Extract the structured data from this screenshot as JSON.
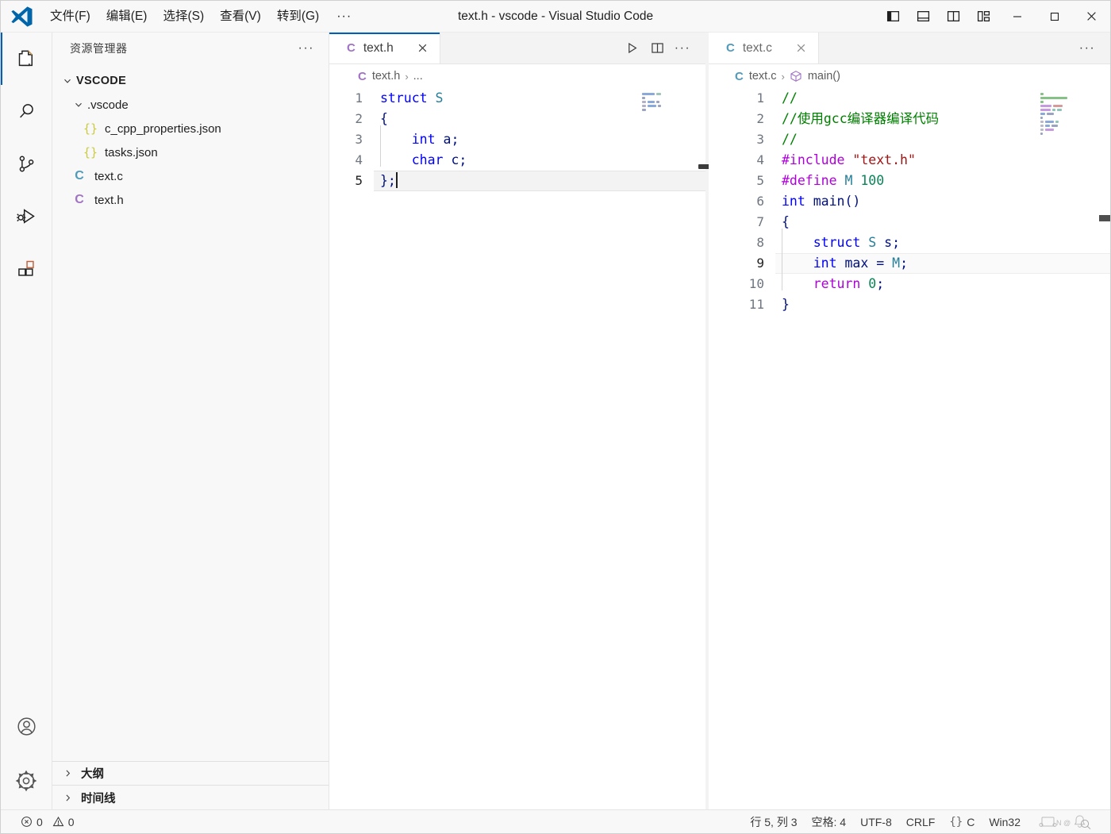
{
  "window": {
    "title": "text.h - vscode - Visual Studio Code",
    "logo_icon": "vscode-logo-icon",
    "menu": [
      {
        "label": "文件(F)",
        "name": "menu-file"
      },
      {
        "label": "编辑(E)",
        "name": "menu-edit"
      },
      {
        "label": "选择(S)",
        "name": "menu-selection"
      },
      {
        "label": "查看(V)",
        "name": "menu-view"
      },
      {
        "label": "转到(G)",
        "name": "menu-go"
      }
    ],
    "menu_more": "···",
    "layout_buttons": [
      {
        "name": "toggle-primary-sidebar-icon",
        "title": "切换主侧栏"
      },
      {
        "name": "toggle-panel-icon",
        "title": "切换面板"
      },
      {
        "name": "toggle-secondary-sidebar-icon",
        "title": "切换辅助侧栏"
      },
      {
        "name": "customize-layout-icon",
        "title": "自定义布局"
      }
    ],
    "controls": [
      {
        "name": "minimize-button",
        "glyph": "minimize-icon"
      },
      {
        "name": "maximize-button",
        "glyph": "maximize-icon"
      },
      {
        "name": "close-button",
        "glyph": "close-icon"
      }
    ]
  },
  "activitybar": {
    "items": [
      {
        "name": "activity-explorer",
        "icon": "files-icon",
        "active": true
      },
      {
        "name": "activity-search",
        "icon": "search-icon",
        "active": false
      },
      {
        "name": "activity-source-control",
        "icon": "source-control-icon",
        "active": false
      },
      {
        "name": "activity-run-debug",
        "icon": "run-and-debug-icon",
        "active": false
      },
      {
        "name": "activity-extensions",
        "icon": "extensions-icon",
        "active": false
      }
    ],
    "bottom": [
      {
        "name": "activity-accounts",
        "icon": "account-icon"
      },
      {
        "name": "activity-settings",
        "icon": "gear-icon"
      }
    ]
  },
  "sidebar": {
    "title": "资源管理器",
    "actions_label": "···",
    "tree": [
      {
        "label": "VSCODE",
        "kind": "root",
        "depth": 0,
        "expanded": true,
        "icon": "chevron-down-icon"
      },
      {
        "label": ".vscode",
        "kind": "folder",
        "depth": 1,
        "expanded": true,
        "icon": "chevron-down-icon"
      },
      {
        "label": "c_cpp_properties.json",
        "kind": "json",
        "depth": 2,
        "icon": "json-file-icon"
      },
      {
        "label": "tasks.json",
        "kind": "json",
        "depth": 2,
        "icon": "json-file-icon"
      },
      {
        "label": "text.c",
        "kind": "c",
        "depth": 1,
        "icon": "c-file-icon"
      },
      {
        "label": "text.h",
        "kind": "h",
        "depth": 1,
        "icon": "h-file-icon"
      }
    ],
    "sections": [
      {
        "label": "大纲",
        "name": "sidebar-section-outline",
        "icon": "chevron-right-icon"
      },
      {
        "label": "时间线",
        "name": "sidebar-section-timeline",
        "icon": "chevron-right-icon"
      }
    ]
  },
  "editor_groups": [
    {
      "name": "editor-group-1",
      "focused": true,
      "tab": {
        "label": "text.h",
        "icon": "h-file-icon",
        "close_icon": "close-icon"
      },
      "actions": [
        {
          "name": "run-code-button",
          "icon": "play-icon"
        },
        {
          "name": "split-editor-right-button",
          "icon": "split-editor-icon"
        },
        {
          "name": "more-actions-button",
          "icon": "ellipsis-icon"
        }
      ],
      "breadcrumb": [
        {
          "label": "text.h",
          "icon": "h-file-icon"
        },
        {
          "label": "...",
          "icon": ""
        }
      ],
      "lines": [
        {
          "n": "1",
          "current": false,
          "tokens": [
            {
              "t": "struct",
              "c": "kw"
            },
            {
              "t": " ",
              "c": "plain"
            },
            {
              "t": "S",
              "c": "typ"
            }
          ]
        },
        {
          "n": "2",
          "current": false,
          "tokens": [
            {
              "t": "{",
              "c": "pun"
            }
          ]
        },
        {
          "n": "3",
          "current": false,
          "indent": true,
          "tokens": [
            {
              "t": "    ",
              "c": "plain"
            },
            {
              "t": "int",
              "c": "kw"
            },
            {
              "t": " ",
              "c": "plain"
            },
            {
              "t": "a",
              "c": "id"
            },
            {
              "t": ";",
              "c": "pun"
            }
          ]
        },
        {
          "n": "4",
          "current": false,
          "indent": true,
          "tokens": [
            {
              "t": "    ",
              "c": "plain"
            },
            {
              "t": "char",
              "c": "kw"
            },
            {
              "t": " ",
              "c": "plain"
            },
            {
              "t": "c",
              "c": "id"
            },
            {
              "t": ";",
              "c": "pun"
            }
          ]
        },
        {
          "n": "5",
          "current": true,
          "cursor": true,
          "tokens": [
            {
              "t": "}",
              "c": "pun"
            },
            {
              "t": ";",
              "c": "pun"
            }
          ]
        }
      ]
    },
    {
      "name": "editor-group-2",
      "focused": false,
      "tab": {
        "label": "text.c",
        "icon": "c-file-icon",
        "close_icon": "close-icon"
      },
      "actions": [
        {
          "name": "more-actions-button",
          "icon": "ellipsis-icon"
        }
      ],
      "breadcrumb": [
        {
          "label": "text.c",
          "icon": "c-file-icon"
        },
        {
          "label": "main()",
          "icon": "symbol-method-icon"
        }
      ],
      "lines": [
        {
          "n": "1",
          "current": false,
          "tokens": [
            {
              "t": "//",
              "c": "cmt"
            }
          ]
        },
        {
          "n": "2",
          "current": false,
          "tokens": [
            {
              "t": "//使用gcc编译器编译代码",
              "c": "cmt"
            }
          ]
        },
        {
          "n": "3",
          "current": false,
          "tokens": [
            {
              "t": "//",
              "c": "cmt"
            }
          ]
        },
        {
          "n": "4",
          "current": false,
          "tokens": [
            {
              "t": "#include",
              "c": "pre"
            },
            {
              "t": " ",
              "c": "plain"
            },
            {
              "t": "\"text.h\"",
              "c": "str"
            }
          ]
        },
        {
          "n": "5",
          "current": false,
          "tokens": [
            {
              "t": "#define",
              "c": "pre"
            },
            {
              "t": " ",
              "c": "plain"
            },
            {
              "t": "M",
              "c": "typ"
            },
            {
              "t": " ",
              "c": "plain"
            },
            {
              "t": "100",
              "c": "num"
            }
          ]
        },
        {
          "n": "6",
          "current": false,
          "tokens": [
            {
              "t": "int",
              "c": "kw"
            },
            {
              "t": " ",
              "c": "plain"
            },
            {
              "t": "main",
              "c": "id"
            },
            {
              "t": "()",
              "c": "pun"
            }
          ]
        },
        {
          "n": "7",
          "current": false,
          "tokens": [
            {
              "t": "{",
              "c": "pun"
            }
          ]
        },
        {
          "n": "8",
          "current": false,
          "indent": true,
          "tokens": [
            {
              "t": "    ",
              "c": "plain"
            },
            {
              "t": "struct",
              "c": "kw"
            },
            {
              "t": " ",
              "c": "plain"
            },
            {
              "t": "S",
              "c": "typ"
            },
            {
              "t": " ",
              "c": "plain"
            },
            {
              "t": "s",
              "c": "id"
            },
            {
              "t": ";",
              "c": "pun"
            }
          ]
        },
        {
          "n": "9",
          "current": true,
          "soft": true,
          "indent": true,
          "tokens": [
            {
              "t": "    ",
              "c": "plain"
            },
            {
              "t": "int",
              "c": "kw"
            },
            {
              "t": " ",
              "c": "plain"
            },
            {
              "t": "max",
              "c": "id"
            },
            {
              "t": " = ",
              "c": "pun"
            },
            {
              "t": "M",
              "c": "typ"
            },
            {
              "t": ";",
              "c": "pun"
            }
          ]
        },
        {
          "n": "10",
          "current": false,
          "indent": true,
          "tokens": [
            {
              "t": "    ",
              "c": "plain"
            },
            {
              "t": "return",
              "c": "ctl"
            },
            {
              "t": " ",
              "c": "plain"
            },
            {
              "t": "0",
              "c": "num"
            },
            {
              "t": ";",
              "c": "pun"
            }
          ]
        },
        {
          "n": "11",
          "current": false,
          "tokens": [
            {
              "t": "}",
              "c": "pun"
            }
          ]
        }
      ]
    }
  ],
  "statusbar": {
    "errors": {
      "icon": "error-icon",
      "count": "0"
    },
    "warnings": {
      "icon": "warning-icon",
      "count": "0"
    },
    "cursor_position": "行 5, 列 3",
    "indentation": "空格: 4",
    "encoding": "UTF-8",
    "eol": "CRLF",
    "language_icon": "{}",
    "language": "C",
    "platform": "Win32",
    "bell_icon": "notifications-bell-icon"
  },
  "colors": {
    "accent": "#005fb8",
    "titlebar_bg": "#f8f8f8",
    "sidebar_bg": "#f8f8f8",
    "editor_bg": "#ffffff",
    "tab_active_bg": "#ffffff",
    "tabbar_bg": "#f3f3f3",
    "c_file_icon": "#519aba",
    "h_file_icon": "#a074c4",
    "json_file_icon": "#cbcb41",
    "comment_green": "#008000",
    "keyword_blue": "#0000ff",
    "preproc_purple": "#af00db",
    "string_red": "#a31515",
    "number_teal": "#098658",
    "type_teal": "#267f99",
    "identifier_navy": "#001080"
  }
}
